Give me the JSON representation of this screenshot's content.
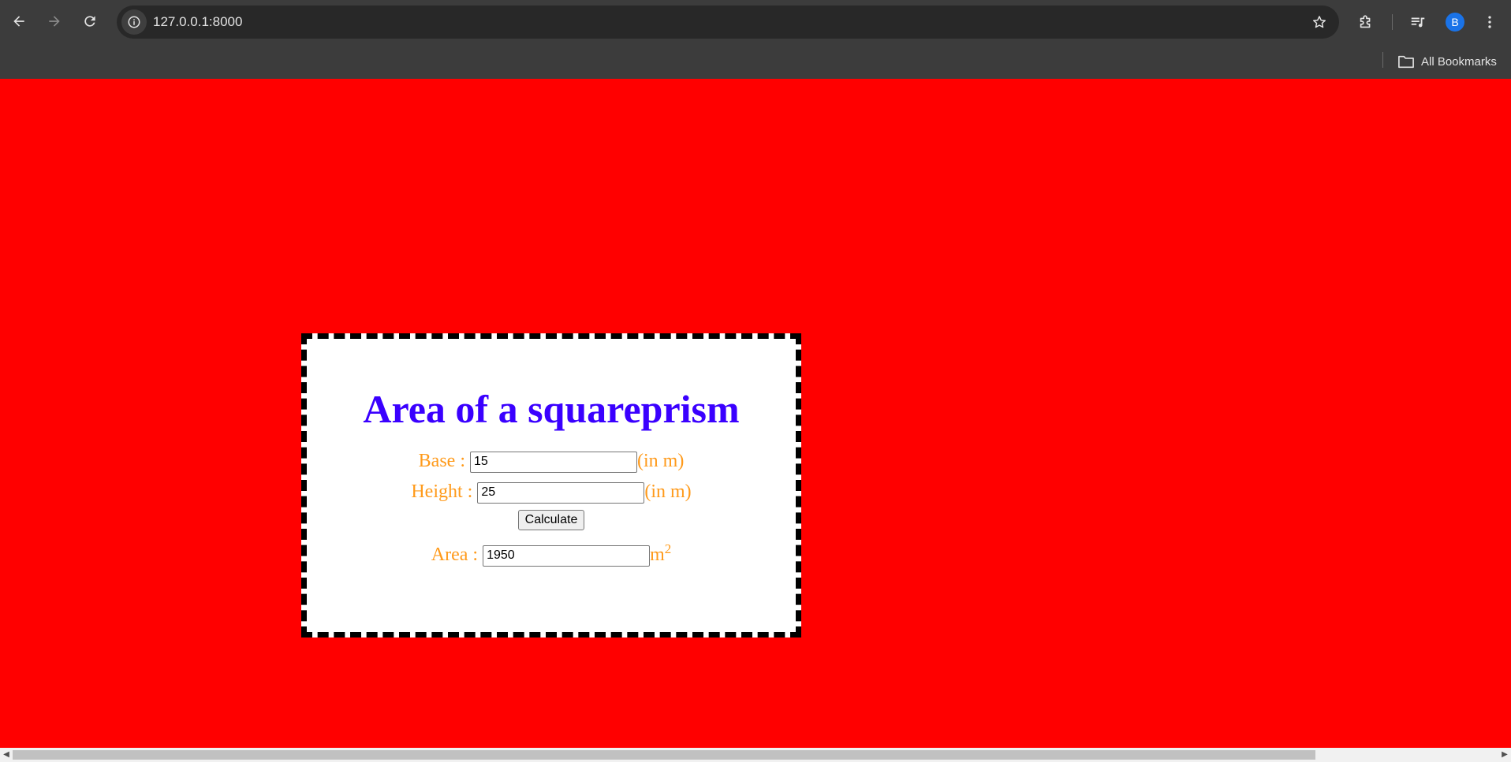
{
  "browser": {
    "url": "127.0.0.1:8000",
    "bookmarks_label": "All Bookmarks",
    "profile_initial": "B",
    "icons": {
      "back": "back-arrow-icon",
      "forward": "forward-arrow-icon",
      "reload": "reload-icon",
      "site_info": "info-icon",
      "bookmark_star": "star-icon",
      "extensions": "puzzle-icon",
      "media": "media-playlist-icon",
      "menu": "kebab-menu-icon",
      "folder": "folder-icon"
    }
  },
  "page": {
    "background_color": "#ff0000",
    "title": "Area of a squareprism",
    "base": {
      "label": "Base :",
      "value": "15",
      "unit": "(in m)"
    },
    "height": {
      "label": "Height :",
      "value": "25",
      "unit": "(in m)"
    },
    "calculate_label": "Calculate",
    "area": {
      "label": "Area :",
      "value": "1950",
      "unit": "m",
      "unit_exponent": "2"
    },
    "colors": {
      "title": "#3a00ff",
      "labels": "#ff9a1a"
    }
  }
}
